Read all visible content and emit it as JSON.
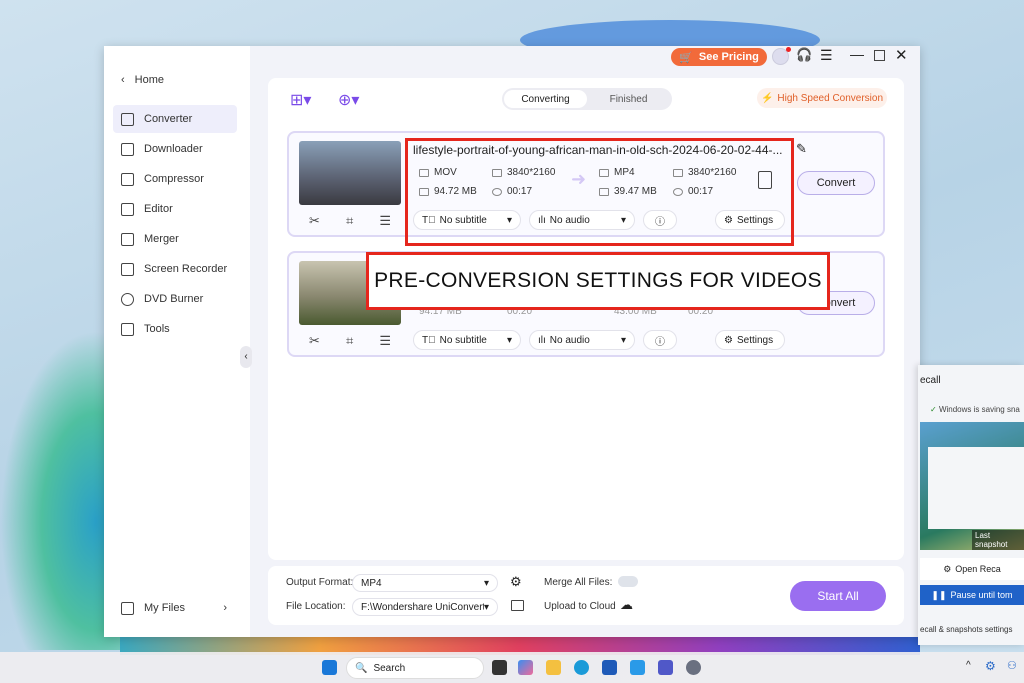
{
  "colors": {
    "accent": "#9a6ef0",
    "pricing": "#f26a3a",
    "highlight": "#e5261d"
  },
  "titlebar": {
    "see_pricing": "See Pricing"
  },
  "sidebar": {
    "home": "Home",
    "items": [
      {
        "label": "Converter",
        "icon": "converter-icon"
      },
      {
        "label": "Downloader",
        "icon": "download-icon"
      },
      {
        "label": "Compressor",
        "icon": "compress-icon"
      },
      {
        "label": "Editor",
        "icon": "scissors-icon"
      },
      {
        "label": "Merger",
        "icon": "merge-icon"
      },
      {
        "label": "Screen Recorder",
        "icon": "record-icon"
      },
      {
        "label": "DVD Burner",
        "icon": "disc-icon"
      },
      {
        "label": "Tools",
        "icon": "grid-icon"
      }
    ],
    "my_files": "My Files"
  },
  "tabs": {
    "converting": "Converting",
    "finished": "Finished"
  },
  "high_speed": "High Speed Conversion",
  "files": [
    {
      "name": "lifestyle-portrait-of-young-african-man-in-old-sch-2024-06-20-02-44-...",
      "src": {
        "format": "MOV",
        "res": "3840*2160",
        "size": "94.72 MB",
        "dur": "00:17"
      },
      "dst": {
        "format": "MP4",
        "res": "3840*2160",
        "size": "39.47 MB",
        "dur": "00:17"
      },
      "subtitle": "No subtitle",
      "audio": "No audio",
      "settings": "Settings",
      "convert": "Convert"
    },
    {
      "src": {
        "size": "94.17 MB",
        "dur": "00:20"
      },
      "dst": {
        "size": "43.00 MB",
        "dur": "00:20"
      },
      "subtitle": "No subtitle",
      "audio": "No audio",
      "settings": "Settings",
      "convert": "Convert"
    }
  ],
  "caption": "PRE-CONVERSION SETTINGS FOR VIDEOS",
  "bottom": {
    "output_format_label": "Output Format:",
    "output_format": "MP4",
    "file_location_label": "File Location:",
    "file_location": "F:\\Wondershare UniConverter 1",
    "merge_label": "Merge All Files:",
    "upload_label": "Upload to Cloud",
    "start_all": "Start All"
  },
  "recall": {
    "title": "ecall",
    "status": "Windows is saving sna",
    "last_snapshot": "Last snapshot",
    "open": "Open Reca",
    "pause": "Pause until tom",
    "settings": "ecall & snapshots settings"
  },
  "taskbar": {
    "search": "Search"
  }
}
